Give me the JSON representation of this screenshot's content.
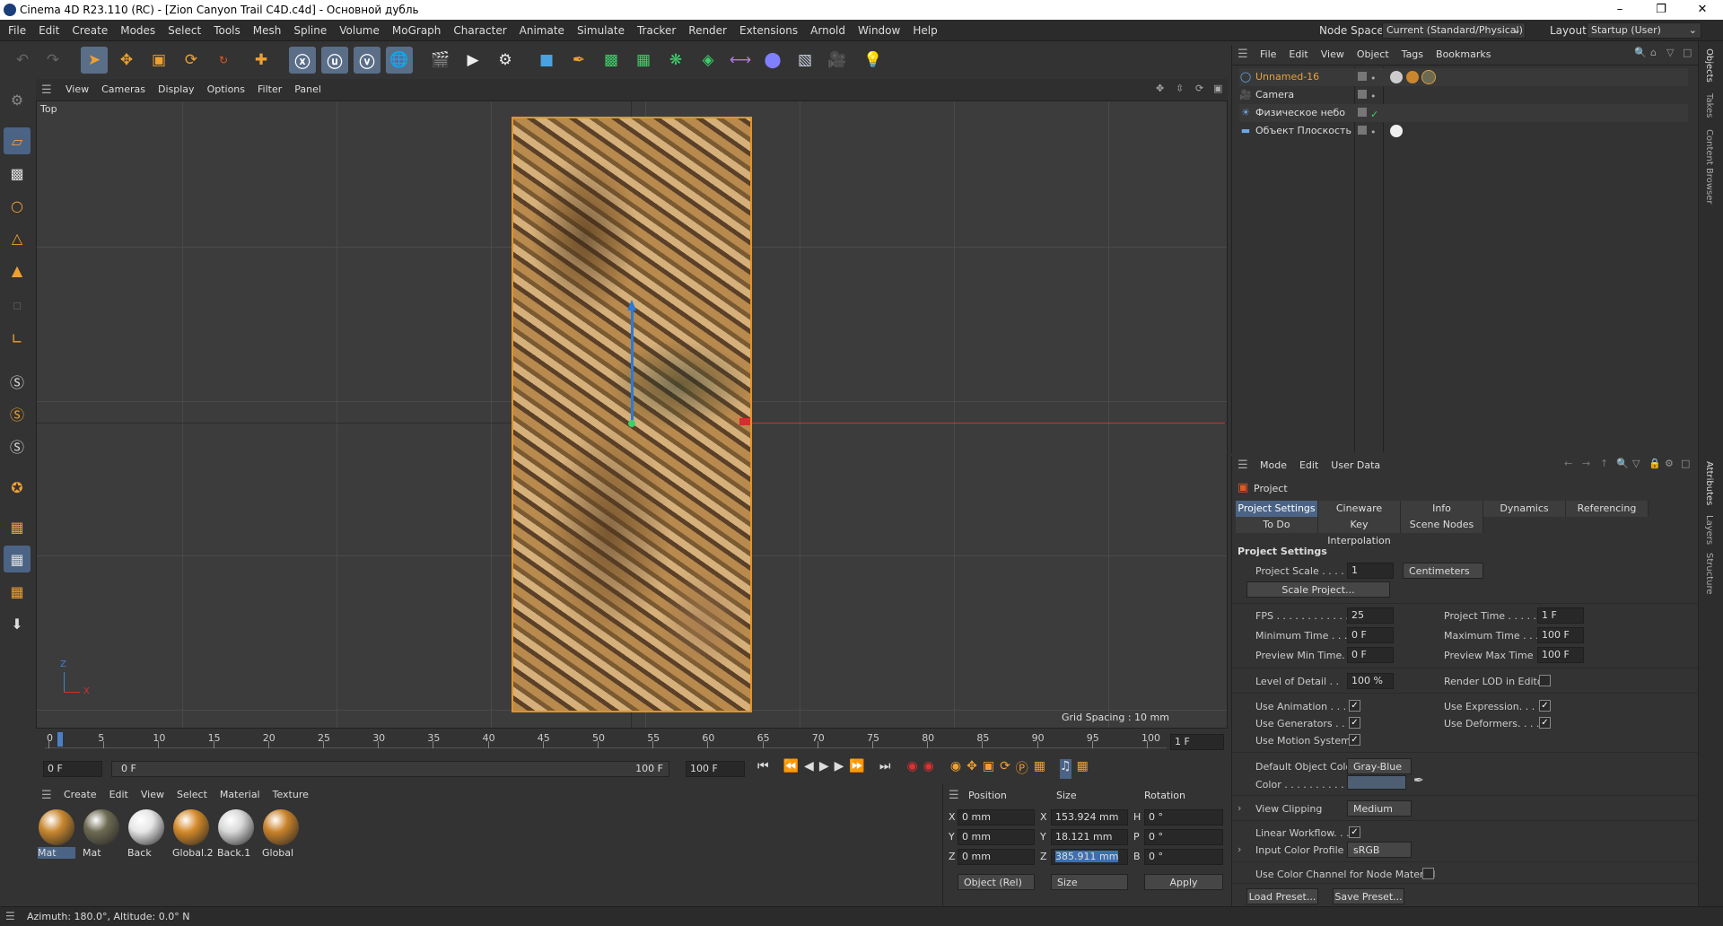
{
  "window": {
    "title": "Cinema 4D R23.110 (RC) - [Zion Canyon Trail C4D.c4d] - Основной дубль",
    "min_icon": "minimize-icon",
    "max_icon": "maximize-icon",
    "close_icon": "close-icon"
  },
  "menubar": {
    "items": [
      "File",
      "Edit",
      "Create",
      "Modes",
      "Select",
      "Tools",
      "Mesh",
      "Spline",
      "Volume",
      "MoGraph",
      "Character",
      "Animate",
      "Simulate",
      "Tracker",
      "Render",
      "Extensions",
      "Arnold",
      "Window",
      "Help"
    ],
    "node_space_label": "Node Space:",
    "node_space_value": "Current (Standard/Physical)",
    "layout_label": "Layout:",
    "layout_value": "Startup (User)"
  },
  "viewport": {
    "menu": [
      "View",
      "Cameras",
      "Display",
      "Options",
      "Filter",
      "Panel"
    ],
    "view_name": "Top",
    "grid_spacing": "Grid Spacing : 10 mm",
    "axis_z": "Z",
    "axis_x": "X"
  },
  "timeline": {
    "ticks": [
      "0",
      "5",
      "10",
      "15",
      "20",
      "25",
      "30",
      "35",
      "40",
      "45",
      "50",
      "55",
      "60",
      "65",
      "70",
      "75",
      "80",
      "85",
      "90",
      "95",
      "100"
    ],
    "current_frame": "1 F",
    "start_field": "0 F",
    "range_start": "0 F",
    "range_end": "100 F",
    "end_field": "100 F"
  },
  "materials": {
    "menu": [
      "Create",
      "Edit",
      "View",
      "Select",
      "Material",
      "Texture"
    ],
    "items": [
      {
        "label": "Mat",
        "color": "#c8872f"
      },
      {
        "label": "Mat",
        "color": "#6d6a52"
      },
      {
        "label": "Back",
        "color": "#e6e6e6"
      },
      {
        "label": "Global.2",
        "color": "#d48a2a"
      },
      {
        "label": "Back.1",
        "color": "#d8d8d8"
      },
      {
        "label": "Global",
        "color": "#c9832b"
      }
    ]
  },
  "coords": {
    "headers": [
      "Position",
      "Size",
      "Rotation"
    ],
    "rows": [
      {
        "axis": "X",
        "pos": "0 mm",
        "size_axis": "X",
        "size": "153.924 mm",
        "rot_axis": "H",
        "rot": "0 °"
      },
      {
        "axis": "Y",
        "pos": "0 mm",
        "size_axis": "Y",
        "size": "18.121 mm",
        "rot_axis": "P",
        "rot": "0 °"
      },
      {
        "axis": "Z",
        "pos": "0 mm",
        "size_axis": "Z",
        "size": "385.911 mm",
        "rot_axis": "B",
        "rot": "0 °"
      }
    ],
    "mode": "Object (Rel)",
    "size_mode": "Size",
    "apply": "Apply"
  },
  "status": {
    "text": "Azimuth: 180.0°, Altitude: 0.0°  N"
  },
  "objects": {
    "menu": [
      "File",
      "Edit",
      "View",
      "Object",
      "Tags",
      "Bookmarks"
    ],
    "items": [
      {
        "name": "Unnamed-16",
        "color": "#e6a23c"
      },
      {
        "name": "Camera",
        "color": "#ddd"
      },
      {
        "name": "Физическое небо",
        "color": "#ddd"
      },
      {
        "name": "Объект Плоскость",
        "color": "#ddd"
      }
    ]
  },
  "side_tabs": {
    "top": [
      "Objects",
      "Takes",
      "Content Browser"
    ],
    "bottom": [
      "Attributes",
      "Layers",
      "Structure"
    ]
  },
  "attributes": {
    "menu": [
      "Mode",
      "Edit",
      "User Data"
    ],
    "object": "Project",
    "tabs1": [
      "Project Settings",
      "Cineware",
      "Info",
      "Dynamics",
      "Referencing"
    ],
    "tabs2": [
      "To Do",
      "Key Interpolation",
      "Scene Nodes"
    ],
    "section": "Project Settings",
    "project_scale_label": "Project Scale . . . . .",
    "project_scale": "1",
    "scale_unit": "Centimeters",
    "scale_button": "Scale Project...",
    "fps_label": "FPS . . . . . . . . . . . .",
    "fps": "25",
    "project_time_label": "Project Time . . . . .",
    "project_time": "1 F",
    "min_time_label": "Minimum Time . . .",
    "min_time": "0 F",
    "max_time_label": "Maximum Time . . .",
    "max_time": "100 F",
    "prev_min_label": "Preview Min Time. .",
    "prev_min": "0 F",
    "prev_max_label": "Preview Max Time .",
    "prev_max": "100 F",
    "lod_label": "Level of Detail . .",
    "lod": "100 %",
    "render_lod_label": "Render LOD in Editor",
    "use_anim_label": "Use Animation . . . .",
    "use_expr_label": "Use Expression. . . .",
    "use_gen_label": "Use Generators . . .",
    "use_def_label": "Use Deformers. . . .",
    "use_motion_label": "Use Motion System",
    "def_color_label": "Default Object Color",
    "def_color": "Gray-Blue",
    "color_label": "Color . . . . . . . . . . .",
    "view_clip_label": "View Clipping",
    "view_clip": "Medium",
    "linear_label": "Linear Workflow. . .",
    "icp_label": "Input Color Profile",
    "icp": "sRGB",
    "ucc_label": "Use Color Channel for Node Material",
    "load_preset": "Load Preset...",
    "save_preset": "Save Preset..."
  }
}
